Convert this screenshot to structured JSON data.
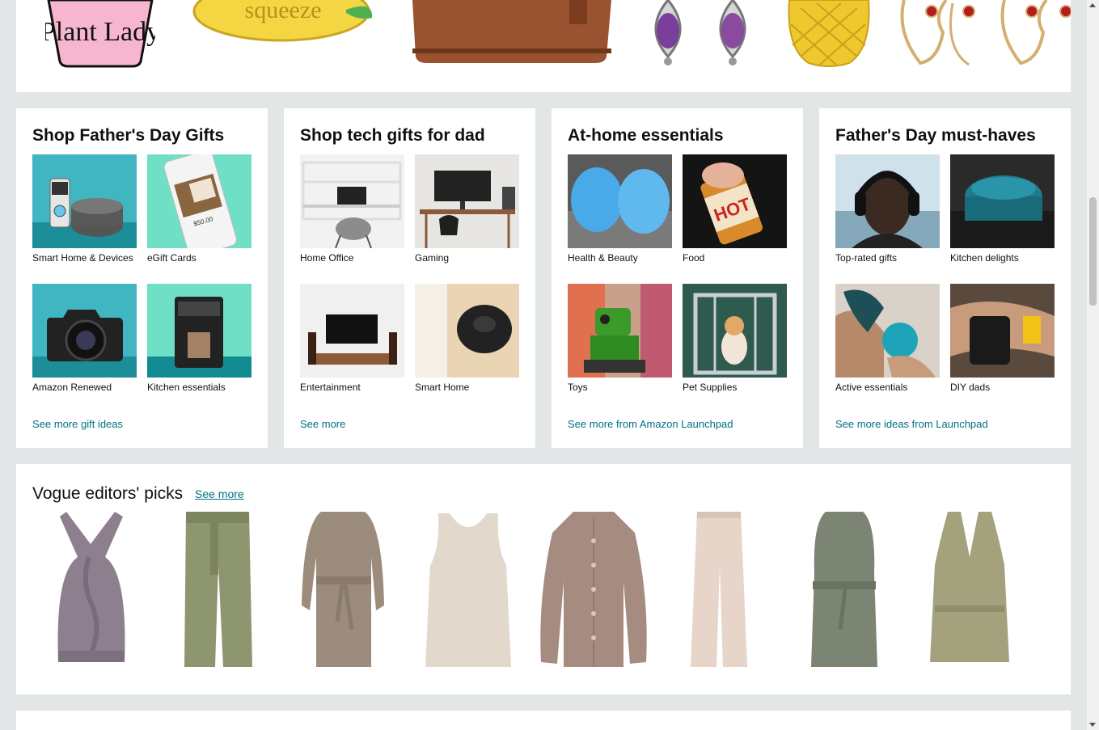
{
  "top_strip": {
    "items": [
      {
        "name": "tumbler-plant-lady",
        "text": "Plant Lady"
      },
      {
        "name": "lemon-squeeze-pin",
        "text": "squeeze"
      },
      {
        "name": "leather-crossbody-bag"
      },
      {
        "name": "amethyst-drop-earrings"
      },
      {
        "name": "pineapple-coin-purse"
      },
      {
        "name": "abstract-face-earrings"
      }
    ]
  },
  "cards": [
    {
      "title": "Shop Father's Day Gifts",
      "tiles": [
        {
          "label": "Smart Home & Devices",
          "icon": "smart-home-devices-image"
        },
        {
          "label": "eGift Cards",
          "icon": "egift-card-image"
        },
        {
          "label": "Amazon Renewed",
          "icon": "camera-image"
        },
        {
          "label": "Kitchen essentials",
          "icon": "coffee-maker-image"
        }
      ],
      "more": "See more gift ideas"
    },
    {
      "title": "Shop tech gifts for dad",
      "tiles": [
        {
          "label": "Home Office",
          "icon": "home-office-image"
        },
        {
          "label": "Gaming",
          "icon": "gaming-desk-image"
        },
        {
          "label": "Entertainment",
          "icon": "tv-stand-image"
        },
        {
          "label": "Smart Home",
          "icon": "robot-vacuum-image"
        }
      ],
      "more": "See more"
    },
    {
      "title": "At-home essentials",
      "tiles": [
        {
          "label": "Health & Beauty",
          "icon": "face-brush-image"
        },
        {
          "label": "Food",
          "icon": "hot-honey-image"
        },
        {
          "label": "Toys",
          "icon": "robot-toy-image"
        },
        {
          "label": "Pet Supplies",
          "icon": "dog-crate-image"
        }
      ],
      "more": "See more from Amazon Launchpad"
    },
    {
      "title": "Father's Day must-haves",
      "tiles": [
        {
          "label": "Top-rated gifts",
          "icon": "headphones-image"
        },
        {
          "label": "Kitchen delights",
          "icon": "dutch-oven-image"
        },
        {
          "label": "Active essentials",
          "icon": "massage-ball-image"
        },
        {
          "label": "DIY dads",
          "icon": "magnetic-wristband-image"
        }
      ],
      "more": "See more ideas from Launchpad"
    }
  ],
  "vogue": {
    "title": "Vogue editors' picks",
    "see_more": "See more",
    "items": [
      {
        "name": "halter-knit-top",
        "color": "#8e7f8e"
      },
      {
        "name": "olive-belted-trousers",
        "color": "#8e9670"
      },
      {
        "name": "knit-wrap-cardigan",
        "color": "#9b8c7d"
      },
      {
        "name": "cream-tank-top",
        "color": "#e3d8cc"
      },
      {
        "name": "satin-button-blouse",
        "color": "#a68b80"
      },
      {
        "name": "wide-leg-trousers",
        "color": "#e6d5c8"
      },
      {
        "name": "sage-trench-coat",
        "color": "#7c8474"
      },
      {
        "name": "olive-sleeveless-vest",
        "color": "#a3a27c"
      }
    ]
  },
  "colors": {
    "link": "#007185",
    "background": "#e3e6e6"
  }
}
